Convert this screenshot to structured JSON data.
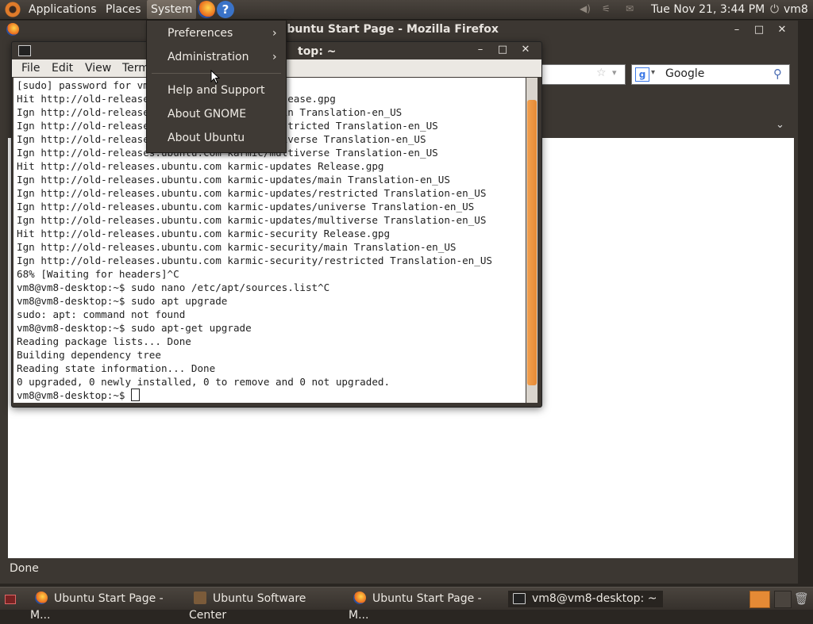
{
  "top_panel": {
    "menus": [
      "Applications",
      "Places",
      "System"
    ],
    "clock": "Tue Nov 21,  3:44 PM",
    "user": "vm8"
  },
  "system_menu": {
    "items": [
      "Preferences",
      "Administration",
      "Help and Support",
      "About GNOME",
      "About Ubuntu"
    ]
  },
  "firefox": {
    "title": "Ubuntu Start Page - Mozilla Firefox",
    "search_value": "Google",
    "status": "Done"
  },
  "terminal": {
    "title": "vm8@vm8-desktop: ~",
    "title_visible": "top: ~",
    "menus": [
      "File",
      "Edit",
      "View",
      "Terminal"
    ],
    "lines": [
      "[sudo] password for vm8:",
      "Hit http://old-releases.ubuntu.com karmic Release.gpg",
      "Ign http://old-releases.ubuntu.com karmic/main Translation-en_US",
      "Ign http://old-releases.ubuntu.com karmic/restricted Translation-en_US",
      "Ign http://old-releases.ubuntu.com karmic/universe Translation-en_US",
      "Ign http://old-releases.ubuntu.com karmic/multiverse Translation-en_US",
      "Hit http://old-releases.ubuntu.com karmic-updates Release.gpg",
      "Ign http://old-releases.ubuntu.com karmic-updates/main Translation-en_US",
      "Ign http://old-releases.ubuntu.com karmic-updates/restricted Translation-en_US",
      "Ign http://old-releases.ubuntu.com karmic-updates/universe Translation-en_US",
      "Ign http://old-releases.ubuntu.com karmic-updates/multiverse Translation-en_US",
      "Hit http://old-releases.ubuntu.com karmic-security Release.gpg",
      "Ign http://old-releases.ubuntu.com karmic-security/main Translation-en_US",
      "Ign http://old-releases.ubuntu.com karmic-security/restricted Translation-en_US",
      "68% [Waiting for headers]^C",
      "vm8@vm8-desktop:~$ sudo nano /etc/apt/sources.list^C",
      "vm8@vm8-desktop:~$ sudo apt upgrade",
      "sudo: apt: command not found",
      "vm8@vm8-desktop:~$ sudo apt-get upgrade",
      "Reading package lists... Done",
      "Building dependency tree",
      "Reading state information... Done",
      "0 upgraded, 0 newly installed, 0 to remove and 0 not upgraded."
    ],
    "prompt": "vm8@vm8-desktop:~$ "
  },
  "taskbar": {
    "items": [
      "Ubuntu Start Page - M...",
      "Ubuntu Software Center",
      "Ubuntu Start Page - M...",
      "vm8@vm8-desktop: ~"
    ]
  },
  "colors": {
    "panel": "#3c3732",
    "accent": "#e58a35",
    "terminal_bg": "#ffffff"
  }
}
